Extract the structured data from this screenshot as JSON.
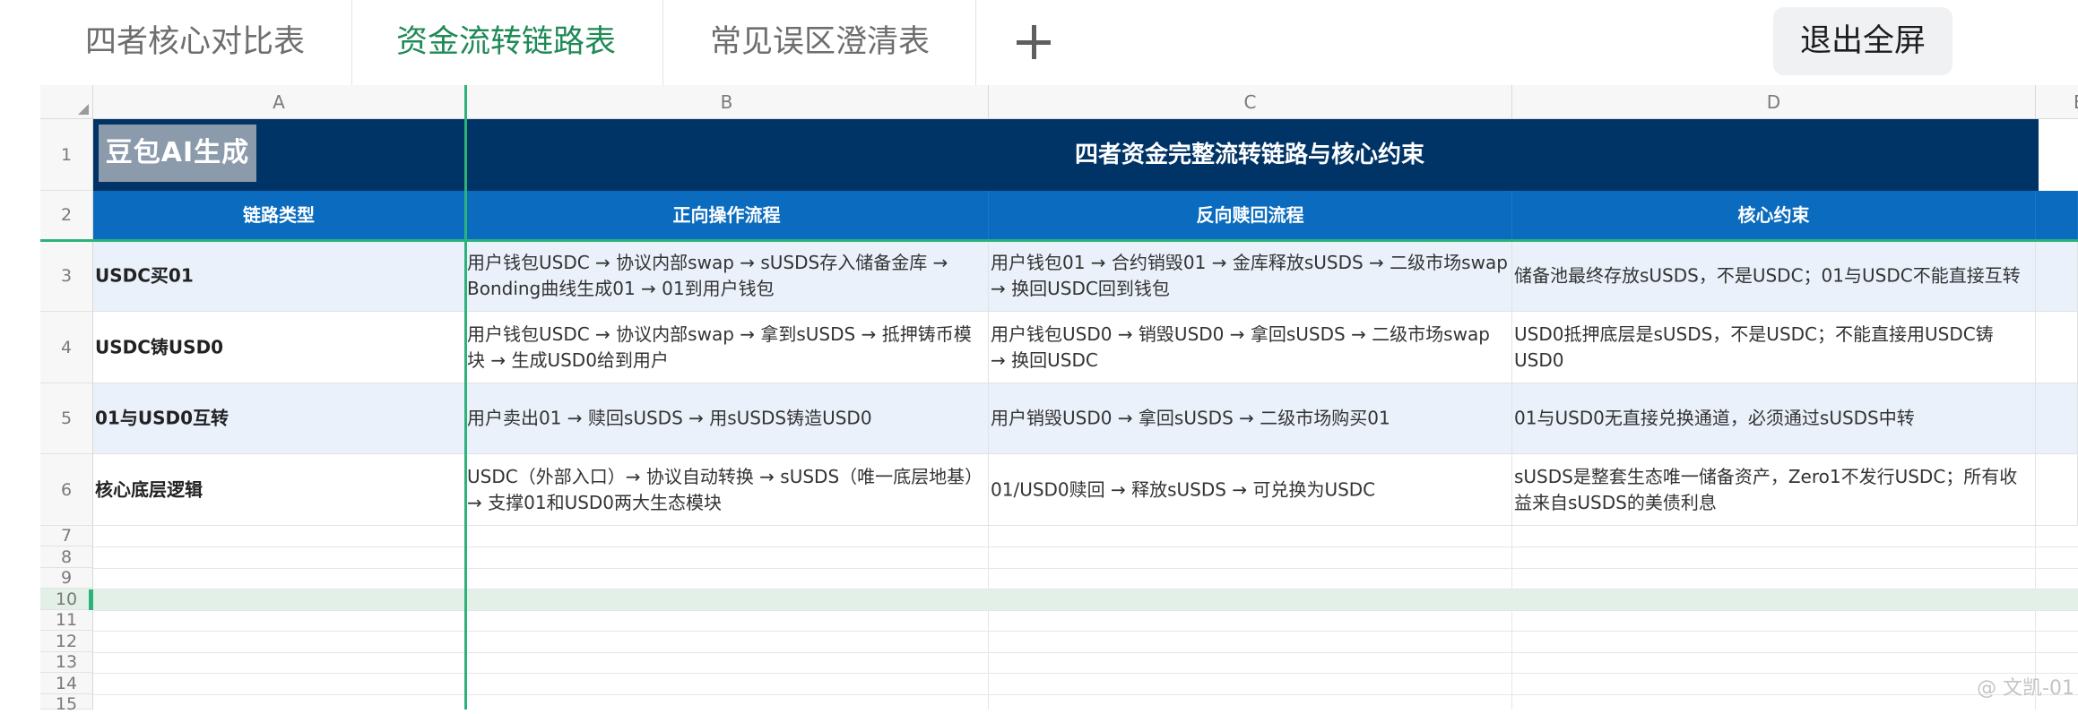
{
  "tabs": [
    {
      "label": "四者核心对比表",
      "active": false
    },
    {
      "label": "资金流转链路表",
      "active": true
    },
    {
      "label": "常见误区澄清表",
      "active": false
    }
  ],
  "toolbar": {
    "exit_label": "退出全屏"
  },
  "columns": [
    "A",
    "B",
    "C",
    "D",
    "E"
  ],
  "row_numbers": [
    "1",
    "2",
    "3",
    "4",
    "5",
    "6",
    "7",
    "8",
    "9",
    "10",
    "11",
    "12",
    "13",
    "14",
    "15"
  ],
  "logo_text": "豆包AI生成",
  "title": "四者资金完整流转链路与核心约束",
  "headers": [
    "链路类型",
    "正向操作流程",
    "反向赎回流程",
    "核心约束"
  ],
  "rows": [
    {
      "type": "USDC买01",
      "forward": "用户钱包USDC → 协议内部swap → sUSDS存入储备金库 → Bonding曲线生成01 → 01到用户钱包",
      "reverse": "用户钱包01 → 合约销毁01 → 金库释放sUSDS → 二级市场swap → 换回USDC回到钱包",
      "constraint": "储备池最终存放sUSDS，不是USDC；01与USDC不能直接互转"
    },
    {
      "type": "USDC铸USD0",
      "forward": "用户钱包USDC → 协议内部swap → 拿到sUSDS → 抵押铸币模块 → 生成USD0给到用户",
      "reverse": "用户钱包USD0 → 销毁USD0 → 拿回sUSDS → 二级市场swap → 换回USDC",
      "constraint": "USD0抵押底层是sUSDS，不是USDC；不能直接用USDC铸USD0"
    },
    {
      "type": "01与USD0互转",
      "forward": "用户卖出01 → 赎回sUSDS → 用sUSDS铸造USD0",
      "reverse": "用户销毁USD0 → 拿回sUSDS → 二级市场购买01",
      "constraint": "01与USD0无直接兑换通道，必须通过sUSDS中转"
    },
    {
      "type": "核心底层逻辑",
      "forward": "USDC（外部入口）→ 协议自动转换 → sUSDS（唯一底层地基）→ 支撑01和USD0两大生态模块",
      "reverse": "01/USD0赎回 → 释放sUSDS → 可兑换为USDC",
      "constraint": "sUSDS是整套生态唯一储备资产，Zero1不发行USDC；所有收益来自sUSDS的美债利息"
    }
  ],
  "selected_row": "10",
  "watermark": "@ 文凯-01",
  "colors": {
    "title_bg": "#003366",
    "header_bg": "#0b6cbf",
    "band": "#eaf1fb",
    "accent": "#2cb37a",
    "active_tab": "#1f8a56"
  }
}
